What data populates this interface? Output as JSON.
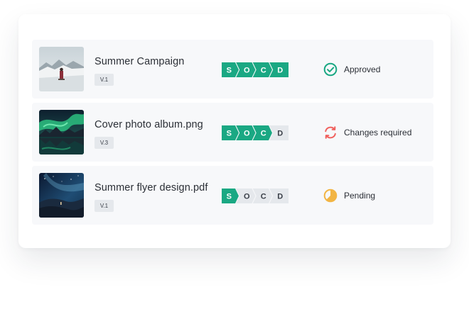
{
  "items": [
    {
      "title": "Summer Campaign",
      "version": "V.1",
      "thumbnail": "snowy-mountain-person-photo",
      "steps": [
        {
          "letter": "S",
          "done": true
        },
        {
          "letter": "O",
          "done": true
        },
        {
          "letter": "C",
          "done": true
        },
        {
          "letter": "D",
          "done": true
        }
      ],
      "status": {
        "label": "Approved",
        "icon": "check-circle-icon",
        "color": "#1aa883"
      }
    },
    {
      "title": "Cover photo album.png",
      "version": "V.3",
      "thumbnail": "aurora-lake-photo",
      "steps": [
        {
          "letter": "S",
          "done": true
        },
        {
          "letter": "O",
          "done": true
        },
        {
          "letter": "C",
          "done": true
        },
        {
          "letter": "D",
          "done": false
        }
      ],
      "status": {
        "label": "Changes required",
        "icon": "refresh-arrows-icon",
        "color": "#f0605d"
      }
    },
    {
      "title": "Summer flyer design.pdf",
      "version": "V.1",
      "thumbnail": "starry-night-hills-photo",
      "steps": [
        {
          "letter": "S",
          "done": true
        },
        {
          "letter": "O",
          "done": false
        },
        {
          "letter": "C",
          "done": false
        },
        {
          "letter": "D",
          "done": false
        }
      ],
      "status": {
        "label": "Pending",
        "icon": "pie-clock-icon",
        "color": "#f2b544"
      }
    }
  ],
  "colors": {
    "step_done": "#1aa883",
    "step_todo": "#e5e8ec",
    "step_done_text": "#ffffff",
    "step_todo_text": "#3a3f48"
  }
}
